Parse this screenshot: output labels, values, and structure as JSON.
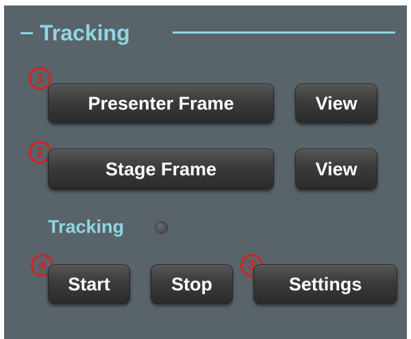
{
  "panel": {
    "title": "Tracking",
    "collapse_symbol": "–",
    "accent_color": "#8fd6e3",
    "background_color": "#59636a"
  },
  "frames": {
    "presenter_frame_label": "Presenter Frame",
    "presenter_view_label": "View",
    "stage_frame_label": "Stage Frame",
    "stage_view_label": "View"
  },
  "tracking_status": {
    "label": "Tracking",
    "indicator_state": "off"
  },
  "controls": {
    "start_label": "Start",
    "stop_label": "Stop",
    "settings_label": "Settings"
  },
  "annotations": {
    "color": "#d62020",
    "badge_1": "1",
    "badge_2": "2",
    "badge_3": "3",
    "badge_4": "4"
  }
}
